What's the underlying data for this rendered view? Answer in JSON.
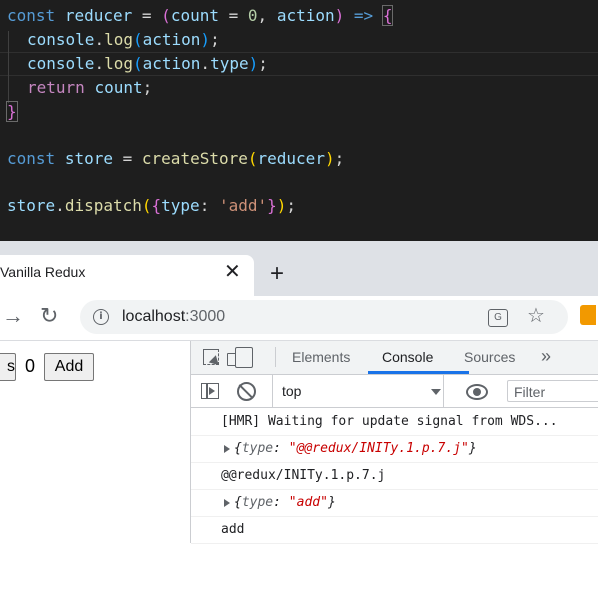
{
  "editor": {
    "code": {
      "line1": {
        "kw": "const",
        "name": "reducer",
        "eq": "=",
        "p_open": "(",
        "param1": "count",
        "eq2": "=",
        "zero": "0",
        "comma": ",",
        "param2": "action",
        "p_close": ")",
        "arrow": "=>",
        "brace": "{"
      },
      "line2": {
        "obj": "console",
        "dot": ".",
        "fn": "log",
        "p_open": "(",
        "arg": "action",
        "p_close": ")",
        "semi": ";"
      },
      "line3": {
        "obj": "console",
        "dot": ".",
        "fn": "log",
        "p_open": "(",
        "arg": "action",
        "dot2": ".",
        "prop": "type",
        "p_close": ")",
        "semi": ";"
      },
      "line4": {
        "kw": "return",
        "val": "count",
        "semi": ";"
      },
      "line5": {
        "brace": "}"
      },
      "line7": {
        "kw": "const",
        "name": "store",
        "eq": "=",
        "fn": "createStore",
        "p_open": "(",
        "arg": "reducer",
        "p_close": ")",
        "semi": ";"
      },
      "line9": {
        "obj": "store",
        "dot": ".",
        "fn": "dispatch",
        "p_open": "(",
        "b_open": "{",
        "key": "type",
        "colon": ":",
        "str": "'add'",
        "b_close": "}",
        "p_close": ")",
        "semi": ";"
      }
    }
  },
  "browser": {
    "tab_title": "Vanilla Redux",
    "close_icon": "close-icon",
    "new_tab_icon": "plus-icon",
    "url_host": "localhost",
    "url_port": ":3000",
    "icons": [
      "forward-icon",
      "reload-icon",
      "info-icon",
      "translate-icon",
      "star-icon",
      "extension-icon"
    ]
  },
  "page": {
    "minus_label": "s",
    "count": "0",
    "add_label": "Add"
  },
  "devtools": {
    "tabs": [
      "Elements",
      "Console",
      "Sources"
    ],
    "more": "»",
    "context": "top",
    "filter_placeholder": "Filter",
    "messages": {
      "m1": "[HMR] Waiting for update signal from WDS...",
      "m2": {
        "open": "{",
        "key": "type",
        "colon": ":",
        "value": "\"@@redux/INITy.1.p.7.j\"",
        "close": "}"
      },
      "m3": "@@redux/INITy.1.p.7.j",
      "m4": {
        "open": "{",
        "key": "type",
        "colon": ":",
        "value": "\"add\"",
        "close": "}"
      },
      "m5": "add"
    }
  },
  "colors": {
    "accent": "#1a73e8",
    "editor_bg": "#1e1e1e",
    "string_red": "#c80000"
  }
}
